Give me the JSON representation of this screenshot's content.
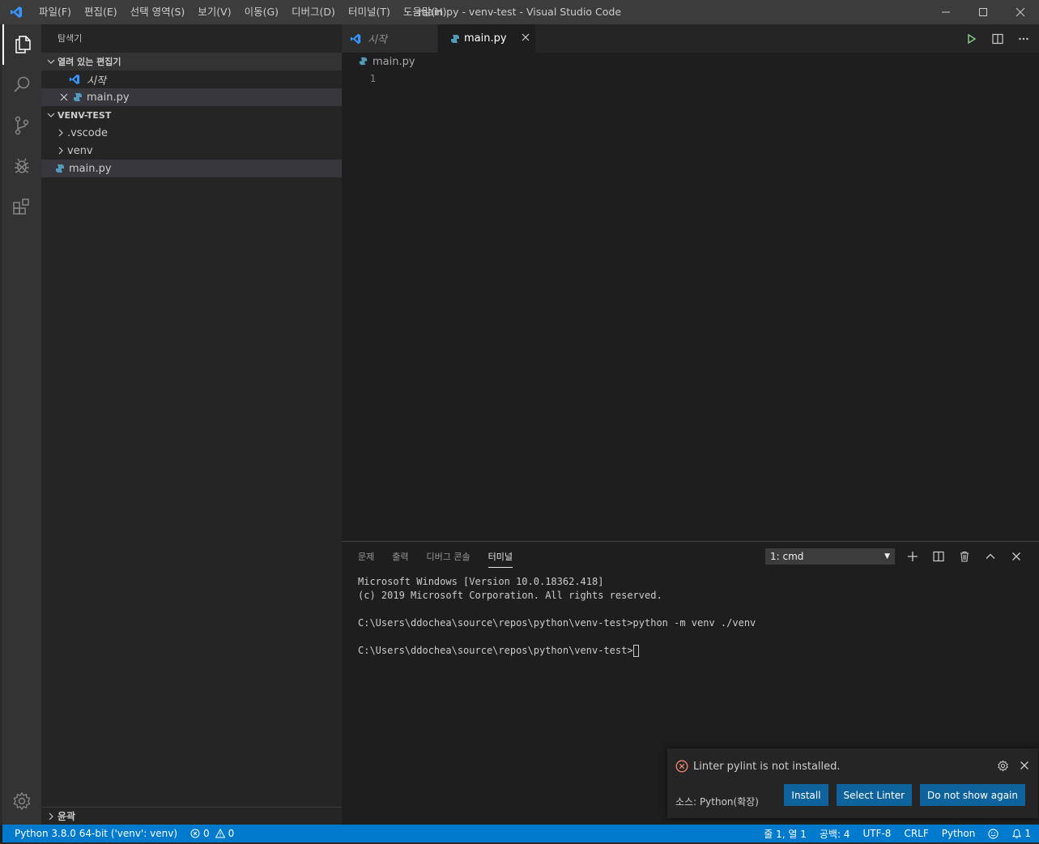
{
  "titlebar": {
    "title": "main.py - venv-test - Visual Studio Code",
    "menu": [
      "파일(F)",
      "편집(E)",
      "선택 영역(S)",
      "보기(V)",
      "이동(G)",
      "디버그(D)",
      "터미널(T)",
      "도움말(H)"
    ]
  },
  "sidebar": {
    "title": "탐색기",
    "open_editors": {
      "header": "열려 있는 편집기",
      "items": [
        "시작",
        "main.py"
      ]
    },
    "project": {
      "header": "VENV-TEST",
      "items": [
        ".vscode",
        "venv",
        "main.py"
      ]
    },
    "outline": "윤곽"
  },
  "editor": {
    "tabs": [
      {
        "label": "시작"
      },
      {
        "label": "main.py"
      }
    ],
    "breadcrumb": "main.py",
    "line_number": "1"
  },
  "panel": {
    "tabs": [
      "문제",
      "출력",
      "디버그 콘솔",
      "터미널"
    ],
    "terminal_select": "1: cmd",
    "terminal_lines": [
      "Microsoft Windows [Version 10.0.18362.418]",
      "(c) 2019 Microsoft Corporation. All rights reserved.",
      "",
      "C:\\Users\\ddochea\\source\\repos\\python\\venv-test>python -m venv ./venv",
      "",
      "C:\\Users\\ddochea\\source\\repos\\python\\venv-test>"
    ]
  },
  "notification": {
    "message": "Linter pylint is not installed.",
    "source": "소스: Python(확장)",
    "buttons": [
      "Install",
      "Select Linter",
      "Do not show again"
    ]
  },
  "statusbar": {
    "interpreter": "Python 3.8.0 64-bit ('venv': venv)",
    "errors": "0",
    "warnings": "0",
    "position": "줄 1, 열 1",
    "spaces": "공백: 4",
    "encoding": "UTF-8",
    "eol": "CRLF",
    "language": "Python",
    "notifications": "1"
  },
  "colors": {
    "accent": "#007acc",
    "button": "#0e639c",
    "error": "#f48771",
    "vscode_blue": "#3794ff",
    "python_blue": "#519aba"
  }
}
